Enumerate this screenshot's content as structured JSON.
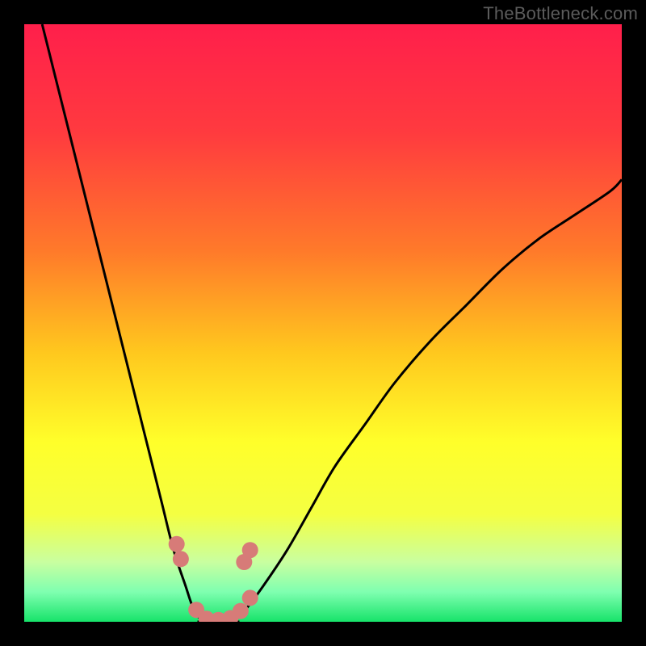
{
  "attribution": "TheBottleneck.com",
  "chart_data": {
    "type": "line",
    "title": "",
    "xlabel": "",
    "ylabel": "",
    "xlim": [
      0,
      100
    ],
    "ylim": [
      0,
      100
    ],
    "gradient_stops": [
      {
        "offset": 0.0,
        "color": "#ff1f4b"
      },
      {
        "offset": 0.18,
        "color": "#ff3a3f"
      },
      {
        "offset": 0.38,
        "color": "#ff7a2a"
      },
      {
        "offset": 0.55,
        "color": "#ffc81e"
      },
      {
        "offset": 0.7,
        "color": "#ffff2a"
      },
      {
        "offset": 0.82,
        "color": "#f4ff42"
      },
      {
        "offset": 0.9,
        "color": "#c9ffa0"
      },
      {
        "offset": 0.95,
        "color": "#7fffb0"
      },
      {
        "offset": 1.0,
        "color": "#17e36a"
      }
    ],
    "series": [
      {
        "name": "left-curve",
        "x": [
          3,
          5,
          7,
          9,
          11,
          13,
          15,
          17,
          19,
          21,
          23,
          25,
          27,
          28,
          29,
          30
        ],
        "y": [
          100,
          92,
          84,
          76,
          68,
          60,
          52,
          44,
          36,
          28,
          20,
          12,
          6,
          3,
          1,
          0
        ]
      },
      {
        "name": "right-curve",
        "x": [
          35,
          37,
          40,
          44,
          48,
          52,
          57,
          62,
          68,
          74,
          80,
          86,
          92,
          98,
          100
        ],
        "y": [
          0,
          2,
          6,
          12,
          19,
          26,
          33,
          40,
          47,
          53,
          59,
          64,
          68,
          72,
          74
        ]
      }
    ],
    "flat_segment": {
      "x0": 29,
      "x1": 36,
      "y": 0
    },
    "markers": [
      {
        "x": 25.5,
        "y": 13.0
      },
      {
        "x": 26.2,
        "y": 10.5
      },
      {
        "x": 28.8,
        "y": 2.0
      },
      {
        "x": 30.5,
        "y": 0.5
      },
      {
        "x": 32.5,
        "y": 0.3
      },
      {
        "x": 34.5,
        "y": 0.6
      },
      {
        "x": 36.2,
        "y": 1.8
      },
      {
        "x": 37.8,
        "y": 4.0
      },
      {
        "x": 36.8,
        "y": 10.0
      },
      {
        "x": 37.8,
        "y": 12.0
      }
    ],
    "marker_style": {
      "r": 10,
      "fill": "#d77b78",
      "stroke": "none"
    },
    "curve_style": {
      "stroke": "#000000",
      "width": 3
    }
  }
}
